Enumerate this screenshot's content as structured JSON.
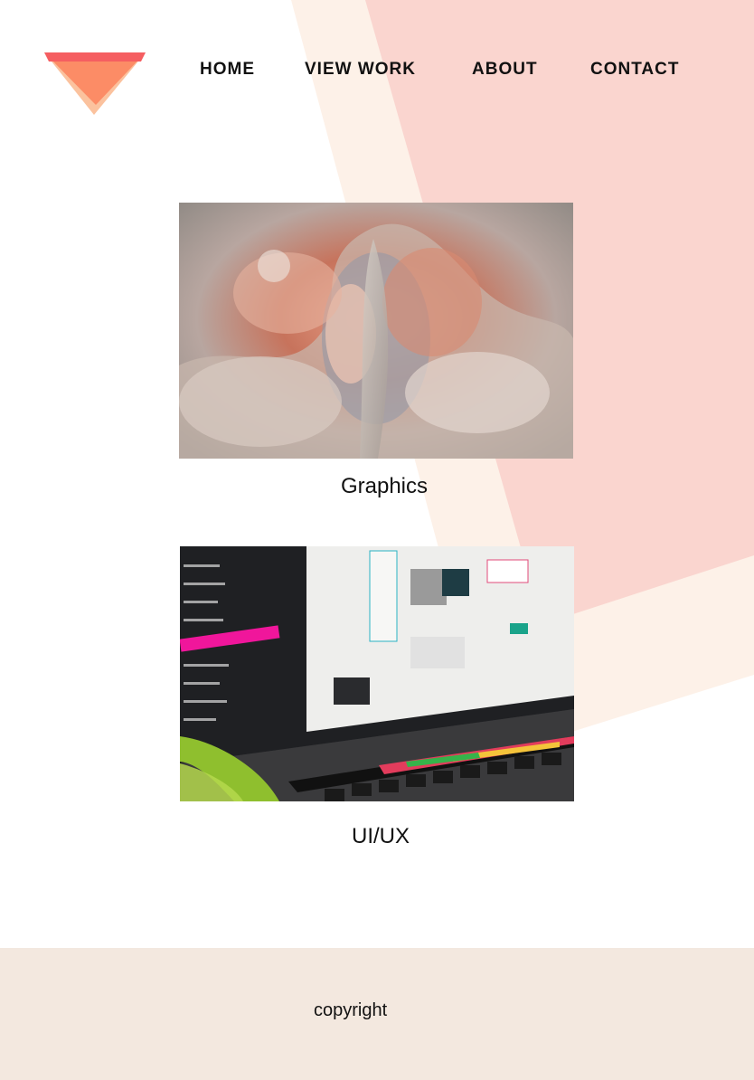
{
  "nav": {
    "home": "HOME",
    "view_work": "VIEW WORK",
    "about": "ABOUT",
    "contact": "CONTACT"
  },
  "portfolio": {
    "items": [
      {
        "label": "Graphics",
        "image": "abstract-3d-render"
      },
      {
        "label": "UI/UX",
        "image": "laptop-ui-design"
      }
    ]
  },
  "footer": {
    "copyright": "copyright"
  },
  "colors": {
    "background": "#ffffff",
    "shape_cream": "#fdf1e8",
    "shape_pink": "#fad5cf",
    "logo_red": "#f55e61",
    "logo_orange": "#fc8c66",
    "logo_peach": "#fbc29e",
    "footer_bg": "#f3e8df"
  }
}
